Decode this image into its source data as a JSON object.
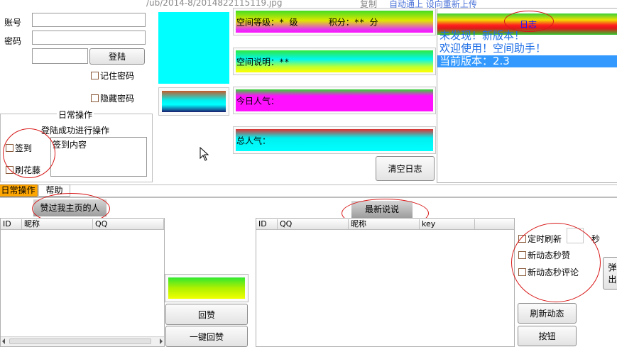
{
  "top_overlay": {
    "path_text": "/ub/2014-8/2014822115119.jpg",
    "copy_text": "复制",
    "fragment_text": "自动通上 设向重新上传"
  },
  "login": {
    "account_label": "账号",
    "password_label": "密码",
    "account_value": "",
    "password_value": "",
    "captcha_value": "",
    "login_button": "登陆",
    "remember_password": "记住密码",
    "hide_password": "隐藏密码"
  },
  "daily": {
    "group_title": "日常操作",
    "hint": "登陆成功进行操作",
    "sign_in": "签到",
    "flower": "刷花藤",
    "sign_content": "签到内容"
  },
  "profile": {
    "level_text": "空间等级：* 级      积分：** 分",
    "desc_text": "空间说明：**",
    "today_text": "今日人气：",
    "total_text": "总人气："
  },
  "clear_log_button": "清空日志",
  "log": {
    "title": "日志",
    "lines": [
      "未发现！新版本！",
      "欢迎使用！空间助手！",
      "当前版本：2.3"
    ]
  },
  "tabs": [
    "日常操作",
    "帮助"
  ],
  "liked_section": {
    "header": "赞过我主页的人",
    "columns": [
      "ID",
      "昵称",
      "QQ"
    ]
  },
  "shuoshuo_section": {
    "header": "最新说说",
    "columns": [
      "ID",
      "QQ",
      "昵称",
      "key"
    ]
  },
  "actions": {
    "reply_like": "回赞",
    "one_click_reply_like": "一键回赞",
    "refresh_feed": "刷新动态",
    "button": "按钮",
    "popup": "弹出",
    "timed_refresh": "定时刷新",
    "seconds": "秒",
    "timed_refresh_value": "",
    "instant_like": "新动态秒赞",
    "instant_comment": "新动态秒评论"
  },
  "colors": {
    "cyan": "#00ffff",
    "magenta": "#ff10ff",
    "yellow_green": "#b6ff00",
    "log_blue": "#1e6ee6",
    "selection": "#3399ff",
    "tab_orange": "#ffa600",
    "annotation_red": "#d81818"
  }
}
